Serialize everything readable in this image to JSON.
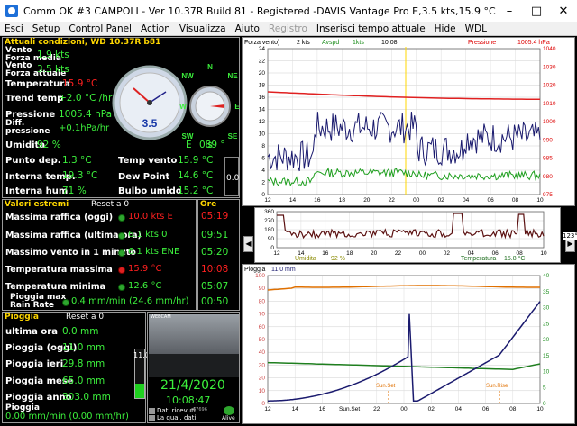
{
  "title": "Comm OK  #3 CAMPOLI - Ver 10.37R Build 81 - Registered  -DAVIS Vantage Pro   E,3.5 kts,15.9 °C",
  "menu": [
    "Esci",
    "Setup",
    "Control Panel",
    "Action",
    "Visualizza",
    "Aiuto",
    "Registro",
    "Inserisci tempo attuale",
    "Hide",
    "WDL"
  ],
  "current": {
    "header": "Attuali condizioni, WD 10.37R b81",
    "rows": [
      {
        "label": "Vento\nForza media",
        "value": "1.9 kts"
      },
      {
        "label": "Vento\nForza attuale",
        "value": "3.5 kts"
      },
      {
        "label": "Temperatura",
        "value": "15.9 °C"
      },
      {
        "label": "Trend temp",
        "value": "+2.0 °C /hr"
      },
      {
        "label": "Pressione",
        "value": "1005.4 hPa"
      },
      {
        "label": "Diff.\npressione",
        "value": "+0.1hPa/hr"
      },
      {
        "label": "Umidita",
        "value": "92 %"
      }
    ],
    "wind_dir": "E",
    "wind_deg": "089 °",
    "gauge_value": "3.5",
    "compass": [
      "N",
      "NE",
      "E",
      "SE",
      "S",
      "SW",
      "W",
      "NW"
    ],
    "bottom": [
      {
        "label": "Punto dep.",
        "value": "1.3 °C"
      },
      {
        "label": "Interna temp.",
        "value": "19.3 °C"
      },
      {
        "label": "Interna hum",
        "value": "71 %"
      }
    ],
    "bottom_right": [
      {
        "label": "Temp vento",
        "value": "15.9 °C"
      },
      {
        "label": "Dew Point",
        "value": "14.6 °C"
      },
      {
        "label": "Bulbo umido",
        "value": "15.2 °C"
      }
    ],
    "side_value": "0.0"
  },
  "extremes": {
    "header": "Valori estremi",
    "reset": "Reset a 0",
    "rows": [
      {
        "label": "Massima raffica (oggi)",
        "value": "10.0 kts   E"
      },
      {
        "label": "Massima raffica (ultima ora)",
        "value": "6.1 kts   0"
      },
      {
        "label": "Massimo vento in 1 minuto",
        "value": "6.1 kts ENE"
      },
      {
        "label": "Temperatura massima",
        "value": "15.9 °C"
      },
      {
        "label": "Temperatura minima",
        "value": "12.6 °C"
      },
      {
        "label": "Pioggia max\nRain Rate",
        "value": "0.4 mm/min (24.6 mm/hr)"
      }
    ]
  },
  "times": {
    "header": "Ore",
    "values": [
      "05:19",
      "09:51",
      "05:20",
      "10:08",
      "05:07",
      "00:50"
    ]
  },
  "rain": {
    "header": "Pioggia",
    "reset": "Reset a 0",
    "rows": [
      {
        "label": "ultima ora",
        "value": "0.0 mm"
      },
      {
        "label": "Pioggia (oggi)",
        "value": "11.0 mm"
      },
      {
        "label": "Pioggia ieri",
        "value": "29.8 mm"
      },
      {
        "label": "Pioggia mese",
        "value": "65.0 mm"
      },
      {
        "label": "Pioggia anno",
        "value": "303.0 mm"
      }
    ],
    "rate_label": "Pioggia",
    "rate": "0.00 mm/min (0.00 mm/hr)",
    "gauge_value": "11.0"
  },
  "camera": {
    "date": "21/4/2020",
    "time": "10:08:47",
    "dati_ricevuti": "Dati ricevuti",
    "qual_dati": "La qual. dati",
    "count": "67696",
    "alive": "Alive",
    "cam_label": "WEBCAM"
  },
  "chart_top": {
    "header": [
      "Forza vento)",
      "2 kts",
      "Avspd",
      "1kts",
      "10:08",
      "Pressione",
      "1005.4 hPa"
    ],
    "yleft": [
      "24",
      "22",
      "20",
      "18",
      "16",
      "14",
      "12",
      "10",
      "8",
      "6",
      "4",
      "2",
      "0"
    ],
    "yright": [
      "1040",
      "1030",
      "1020",
      "1010",
      "1000",
      "990",
      "985",
      "980",
      "975"
    ],
    "x": [
      "12",
      "14",
      "16",
      "18",
      "20",
      "22",
      "00",
      "02",
      "04",
      "06",
      "08",
      "10"
    ]
  },
  "chart_mid": {
    "yleft": [
      "360",
      "270",
      "180",
      "90",
      "0"
    ],
    "right": [
      "123°"
    ],
    "x": [
      "12",
      "14",
      "16",
      "18",
      "20",
      "22",
      "00",
      "02",
      "04",
      "06",
      "08",
      "10"
    ],
    "legend": [
      "Umidita",
      "92 %",
      "Temperatura",
      "15.8 °C"
    ]
  },
  "chart_bottom": {
    "header": [
      "Pioggia",
      "11.0 mm"
    ],
    "yleft": [
      "100",
      "90",
      "80",
      "70",
      "60",
      "50",
      "40",
      "30",
      "20",
      "10",
      "0"
    ],
    "yright": [
      "40",
      "35",
      "30",
      "25",
      "20",
      "15",
      "10",
      "5",
      "0"
    ],
    "x": [
      "12",
      "14",
      "16",
      "Sun.Set",
      "22",
      "00",
      "02",
      "04",
      "06",
      "08",
      "10"
    ],
    "ann": [
      "Sun.Set",
      "Sun.Rise"
    ]
  },
  "colors": {
    "yellow": "#ffd700",
    "green": "#3cf03c",
    "red": "#ff2020",
    "navy": "#1a1a6e",
    "cyan": "#00c0ff"
  }
}
